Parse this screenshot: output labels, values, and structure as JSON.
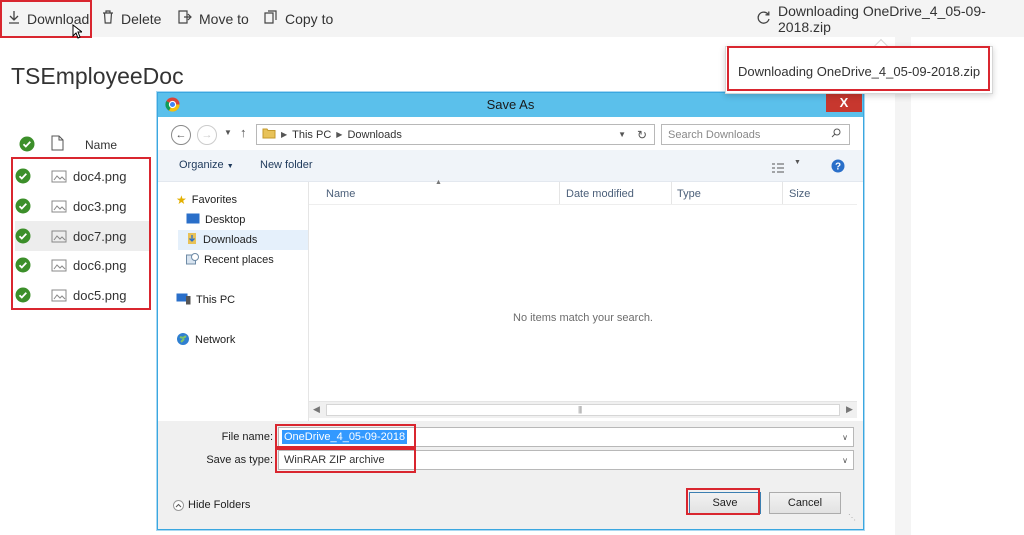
{
  "commandbar": {
    "download_label": "Download",
    "delete_label": "Delete",
    "move_label": "Move to",
    "copy_label": "Copy to",
    "status_text": "Downloading OneDrive_4_05-09-2018.zip"
  },
  "tooltip": {
    "text": "Downloading OneDrive_4_05-09-2018.zip"
  },
  "page": {
    "title": "TSEmployeeDoc",
    "name_header": "Name",
    "files": [
      {
        "name": "doc4.png"
      },
      {
        "name": "doc3.png"
      },
      {
        "name": "doc7.png"
      },
      {
        "name": "doc6.png"
      },
      {
        "name": "doc5.png"
      }
    ]
  },
  "dialog": {
    "title": "Save As",
    "close_label": "X",
    "breadcrumb": [
      "This PC",
      "Downloads"
    ],
    "search_placeholder": "Search Downloads",
    "organize_label": "Organize",
    "new_folder_label": "New folder",
    "nav": {
      "favorites": "Favorites",
      "desktop": "Desktop",
      "downloads": "Downloads",
      "recent": "Recent places",
      "this_pc": "This PC",
      "network": "Network"
    },
    "columns": {
      "name": "Name",
      "date": "Date modified",
      "type": "Type",
      "size": "Size"
    },
    "empty_message": "No items match your search.",
    "file_name_label": "File name:",
    "file_name_value": "OneDrive_4_05-09-2018",
    "save_type_label": "Save as type:",
    "save_type_value": "WinRAR ZIP archive",
    "hide_folders_label": "Hide Folders",
    "save_label": "Save",
    "cancel_label": "Cancel"
  },
  "colors": {
    "accent_green": "#3c8f2a",
    "dialog_title": "#5bc0eb",
    "highlight_red": "#d9262f",
    "selection_blue": "#3399ff"
  }
}
